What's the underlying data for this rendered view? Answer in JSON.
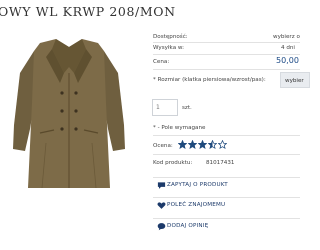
{
  "product": {
    "title": "OWY WL KRWP 208/MON",
    "image_alt": "wool army coat"
  },
  "details": {
    "availability_label": "Dostępność:",
    "availability_value": "wybierz o",
    "shipping_label": "Wysyłka w:",
    "shipping_value": "4 dni",
    "price_label": "Cena:",
    "price_value": "50,00"
  },
  "size": {
    "label": "* Rozmiar (klatka piersiowa/wzrost/pas):",
    "select_value": "wybier"
  },
  "quantity": {
    "value": "1",
    "unit": "szt."
  },
  "required_note": "* - Pole wymagane",
  "rating": {
    "label": "Ocena:",
    "value": 3.5,
    "max": 5,
    "color": "#1f4a7d"
  },
  "product_code": {
    "label": "Kod produktu:",
    "value": "81017431"
  },
  "actions": {
    "ask": "ZAPYTAJ O PRODUKT",
    "recommend": "POLEĆ ZNAJOMEMU",
    "review": "DODAJ OPINIĘ"
  },
  "colors": {
    "accent": "#1c3a6a",
    "coat": "#7d6b48"
  }
}
